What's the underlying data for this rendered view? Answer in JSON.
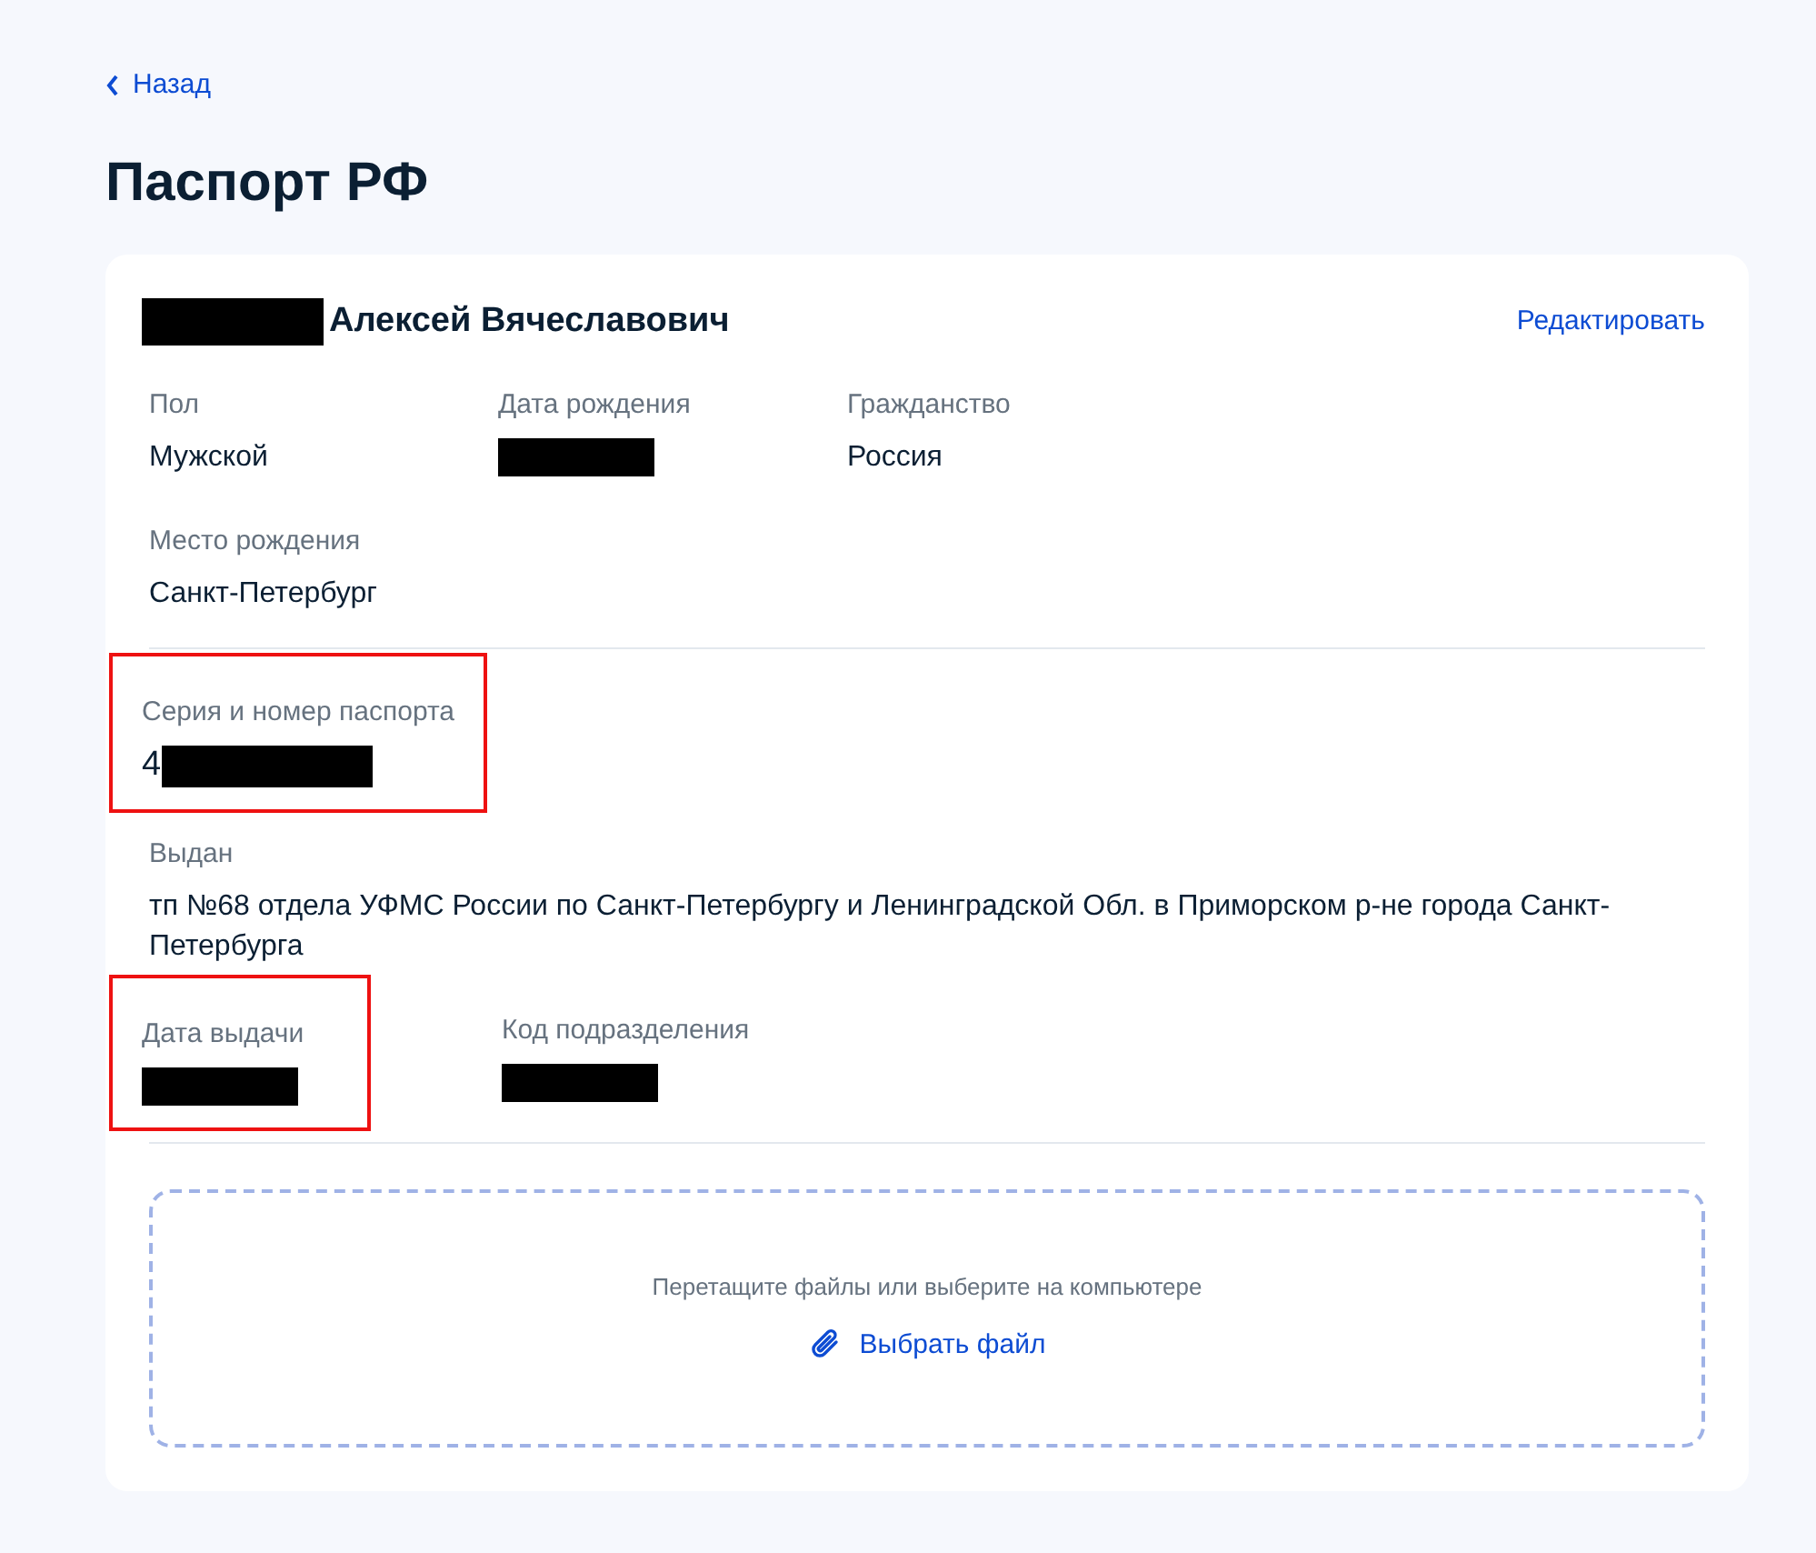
{
  "back_link": {
    "label": "Назад"
  },
  "title": "Паспорт РФ",
  "card": {
    "holder": {
      "name_redacted": true,
      "name": "Алексей Вячеславович"
    },
    "edit_link": "Редактировать",
    "sections": [
      {
        "rows": [
          [
            {
              "label": "Пол",
              "value": "Мужской"
            },
            {
              "label": "Дата рождения",
              "redacted": true
            },
            {
              "label": "Гражданство",
              "value": "Россия"
            }
          ],
          [
            {
              "label": "Место рождения",
              "value": "Санкт-Петербург"
            }
          ]
        ]
      },
      {
        "rows": [
          [
            {
              "label": "Серия и номер паспорта",
              "value": "4",
              "redacted": true,
              "highlighted": true,
              "large": true
            }
          ],
          [
            {
              "label": "Выдан",
              "value": "тп №68 отдела УФМС России по Санкт-Петербургу и Ленинградской Обл. в Приморском р-не города Санкт-Петербурга"
            }
          ],
          [
            {
              "label": "Дата выдачи",
              "redacted": true,
              "highlighted": true
            },
            {
              "label": "Код подразделения",
              "redacted": true
            }
          ]
        ]
      }
    ],
    "upload": {
      "hint": "Перетащите файлы или выберите на компьютере",
      "button": "Выбрать файл"
    }
  }
}
